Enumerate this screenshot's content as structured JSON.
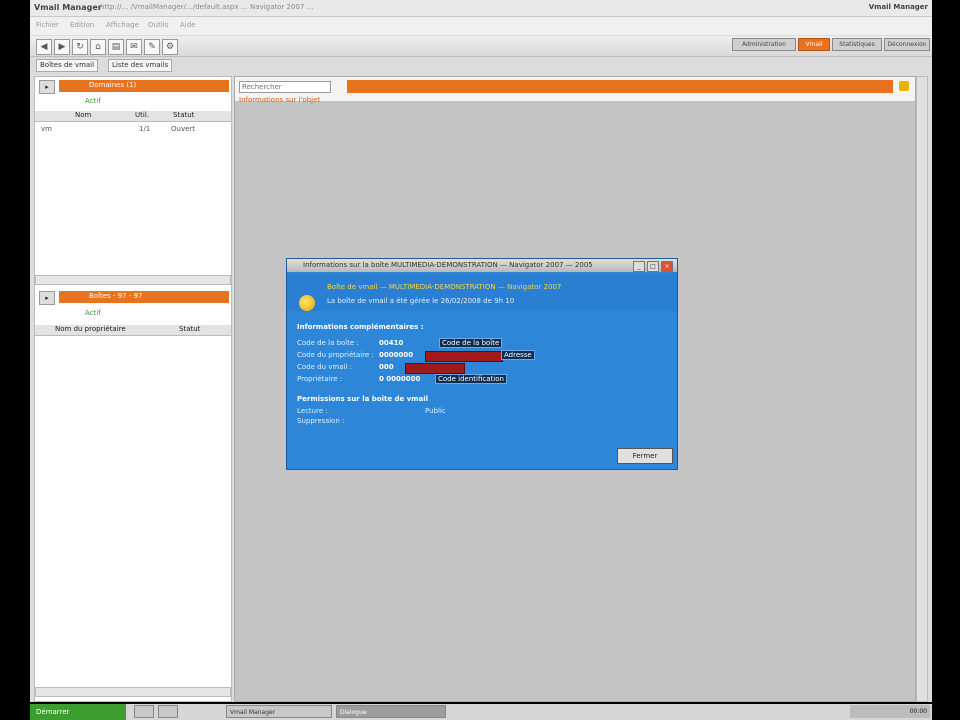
{
  "window": {
    "title": "Vmail Manager",
    "uri": "http://… /VmailManager/…/default.aspx … Navigator 2007 …",
    "user": "Vmail Manager"
  },
  "menus": [
    "Fichier",
    "Edition",
    "Affichage",
    "Outils",
    "Aide"
  ],
  "top_nav": [
    "Administration",
    "Vmail",
    "Statistiques",
    "Déconnexion"
  ],
  "subtabs": [
    "Boîtes de vmail",
    "Liste des vmails"
  ],
  "left_panel": {
    "section1_title": "Domaines (1)",
    "section1_green": "Actif",
    "table_headers": [
      "Nom",
      "Util.",
      "Statut"
    ],
    "row": {
      "name": "vm",
      "util": "1/1",
      "status": "Ouvert"
    },
    "section2_title": "Boîtes - 97 - 97",
    "section2_green": "Actif",
    "table2_headers": [
      "Nom du propriétaire",
      "Statut"
    ]
  },
  "content": {
    "search_placeholder": "Rechercher",
    "info_link": "Informations sur l'objet"
  },
  "dialog": {
    "title": "Informations sur la boîte MULTIMEDIA-DEMONSTRATION — Navigator 2007 — 2005",
    "heading": "Boîte de vmail — MULTIMEDIA-DEMONSTRATION — Navigator 2007",
    "subheading": "La boîte de vmail a été gérée le 26/02/2008 de 9h 10",
    "section_info": "Informations complémentaires :",
    "fields": [
      {
        "label": "Code de la boîte :",
        "value": "00410",
        "extra": "Code de la boîte"
      },
      {
        "label": "Code du propriétaire :",
        "value": "0000000",
        "extra": "Adresse"
      },
      {
        "label": "Code du vmail :",
        "value": "000",
        "extra": ""
      },
      {
        "label": "Propriétaire :",
        "value": "0 0000000",
        "extra": "Code identification"
      }
    ],
    "section_perms": "Permissions sur la boîte de vmail",
    "perms": [
      {
        "label": "Lecture :",
        "value": "Public"
      },
      {
        "label": "Suppression :",
        "value": ""
      }
    ],
    "close_label": "Fermer"
  },
  "taskbar": {
    "start": "Démarrer",
    "tasks": [
      "",
      "",
      "Vmail Manager",
      "Dialogue"
    ],
    "tray": "00:00"
  },
  "colors": {
    "accent": "#e8731e",
    "dialog": "#2e86d8",
    "start": "#3c9e2e"
  }
}
